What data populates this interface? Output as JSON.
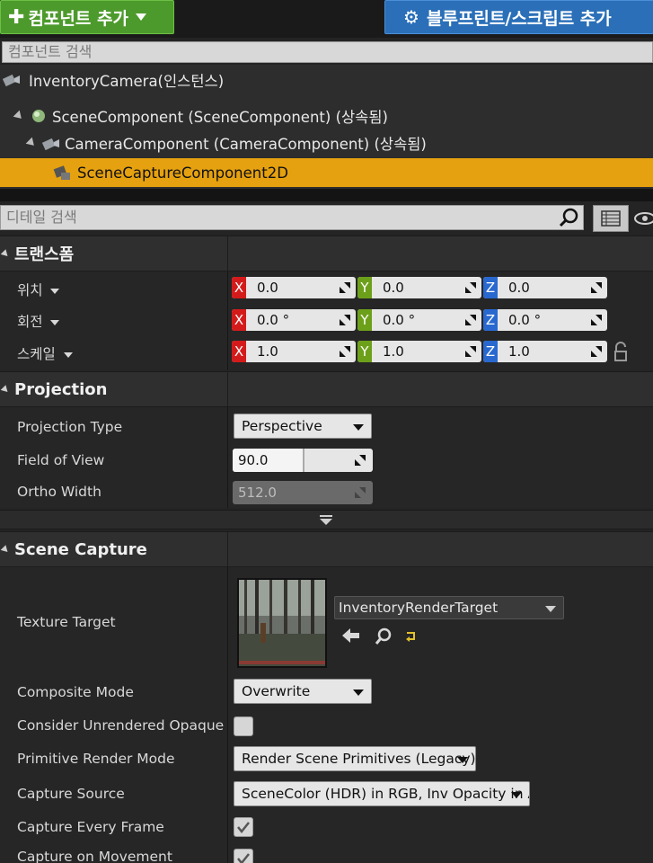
{
  "toolbar": {
    "add_component_label": "컴포넌트 추가",
    "blueprint_script_label": "블루프린트/스크립트 추가"
  },
  "component_search": {
    "placeholder": "컴포넌트 검색"
  },
  "tree": {
    "root": "InventoryCamera(인스턴스)",
    "items": [
      {
        "label": "SceneComponent (SceneComponent) (상속됨)"
      },
      {
        "label": "CameraComponent (CameraComponent) (상속됨)"
      },
      {
        "label": "SceneCaptureComponent2D"
      }
    ]
  },
  "detail_search": {
    "placeholder": "디테일 검색"
  },
  "transform": {
    "title": "트랜스폼",
    "location": {
      "label": "위치",
      "x": "0.0",
      "y": "0.0",
      "z": "0.0"
    },
    "rotation": {
      "label": "회전",
      "x": "0.0 °",
      "y": "0.0 °",
      "z": "0.0 °"
    },
    "scale": {
      "label": "스케일",
      "x": "1.0",
      "y": "1.0",
      "z": "1.0"
    },
    "axis_x": "X",
    "axis_y": "Y",
    "axis_z": "Z"
  },
  "projection": {
    "title": "Projection",
    "type_label": "Projection Type",
    "type_value": "Perspective",
    "fov_label": "Field of View",
    "fov_value": "90.0",
    "ortho_label": "Ortho Width",
    "ortho_value": "512.0"
  },
  "scene_capture": {
    "title": "Scene Capture",
    "texture_target_label": "Texture Target",
    "texture_target_value": "InventoryRenderTarget",
    "composite_label": "Composite Mode",
    "composite_value": "Overwrite",
    "consider_label": "Consider Unrendered Opaque Pix",
    "primitive_label": "Primitive Render Mode",
    "primitive_value": "Render Scene Primitives (Legacy)",
    "capture_source_label": "Capture Source",
    "capture_source_value": "SceneColor (HDR) in RGB, Inv Opacity in A",
    "capture_every_frame_label": "Capture Every Frame",
    "capture_on_movement_label": "Capture on Movement"
  },
  "colors": {
    "add_button": "#4d9a2c",
    "blueprint_button": "#2a6fb8",
    "selection": "#e5a10f"
  }
}
